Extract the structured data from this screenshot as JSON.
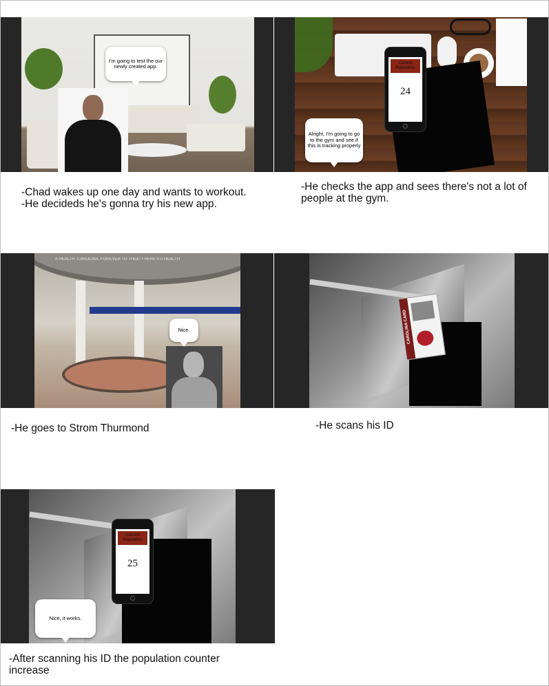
{
  "panels": [
    {
      "caption": "-Chad wakes up one day and wants to workout.\n-He decideds he's gonna try his new app.",
      "bubble": "I'm going to test the our newly created app."
    },
    {
      "caption": "-He checks the app and sees there's not a lot of people at the gym.",
      "bubble": "Alright, I'm going to go to the gym and see if this is tracking properly",
      "phone": {
        "header": "Current Population",
        "count": "24"
      }
    },
    {
      "caption": "-He goes to Strom Thurmond",
      "bubble": "Nice.",
      "dome_text": "A HEALTH, CAROLINA, FOREVER TO THEE! • HERE'S A HEALTH"
    },
    {
      "caption": "-He scans his ID",
      "id_card": "CAROLINA CARD"
    },
    {
      "caption": "-After scanning his ID the population counter increase",
      "bubble": "Nice, it works.",
      "phone": {
        "header": "Current Population",
        "count": "25"
      }
    }
  ]
}
